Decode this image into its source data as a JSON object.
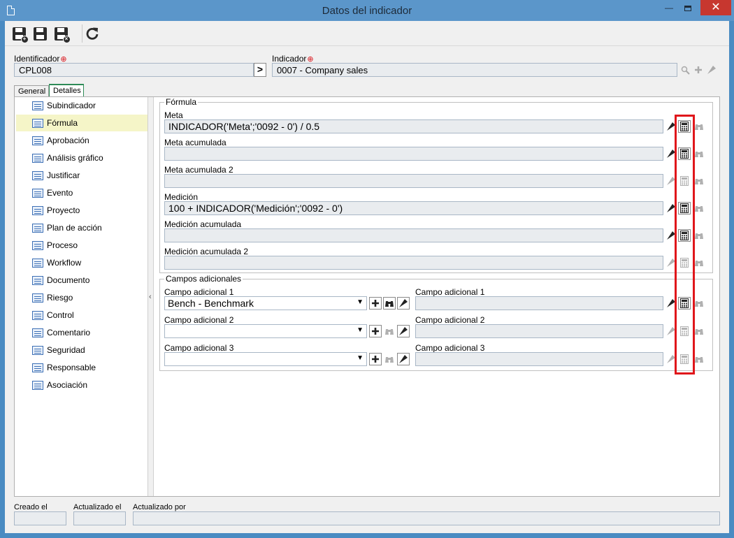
{
  "window": {
    "title": "Datos del indicador"
  },
  "toolbar": {
    "save_new": "save-new",
    "save": "save",
    "save_close": "save-close",
    "refresh": "refresh"
  },
  "header": {
    "id_label": "Identificador",
    "id_value": "CPL008",
    "indicator_label": "Indicador",
    "indicator_value": "0007 - Company sales",
    "required_mark": "⊕"
  },
  "tabs": [
    {
      "label": "General"
    },
    {
      "label": "Detalles"
    }
  ],
  "sidebar": {
    "items": [
      {
        "label": "Subindicador"
      },
      {
        "label": "Fórmula"
      },
      {
        "label": "Aprobación"
      },
      {
        "label": "Análisis gráfico"
      },
      {
        "label": "Justificar"
      },
      {
        "label": "Evento"
      },
      {
        "label": "Proyecto"
      },
      {
        "label": "Plan de acción"
      },
      {
        "label": "Proceso"
      },
      {
        "label": "Workflow"
      },
      {
        "label": "Documento"
      },
      {
        "label": "Riesgo"
      },
      {
        "label": "Control"
      },
      {
        "label": "Comentario"
      },
      {
        "label": "Seguridad"
      },
      {
        "label": "Responsable"
      },
      {
        "label": "Asociación"
      }
    ],
    "active": "Fórmula"
  },
  "formula": {
    "group_title": "Fórmula",
    "fields": [
      {
        "label": "Meta",
        "value": "INDICADOR('Meta';'0092 - 0') / 0.5"
      },
      {
        "label": "Meta acumulada",
        "value": ""
      },
      {
        "label": "Meta acumulada 2",
        "value": ""
      },
      {
        "label": "Medición",
        "value": "100 + INDICADOR('Medición';'0092 - 0')"
      },
      {
        "label": "Medición acumulada",
        "value": ""
      },
      {
        "label": "Medición acumulada 2",
        "value": ""
      }
    ]
  },
  "campos": {
    "group_title": "Campos adicionales",
    "rows": [
      {
        "left_label": "Campo adicional 1",
        "left_value": "Bench - Benchmark",
        "right_label": "Campo adicional 1",
        "right_value": ""
      },
      {
        "left_label": "Campo adicional 2",
        "left_value": "",
        "right_label": "Campo adicional 2",
        "right_value": ""
      },
      {
        "left_label": "Campo adicional 3",
        "left_value": "",
        "right_label": "Campo adicional 3",
        "right_value": ""
      }
    ]
  },
  "footer": {
    "created_label": "Creado el",
    "updated_label": "Actualizado el",
    "updated_by_label": "Actualizado por"
  },
  "colors": {
    "highlight": "#e0161b",
    "titlebar": "#5b96ca",
    "active_tab": "#2e8b57"
  }
}
